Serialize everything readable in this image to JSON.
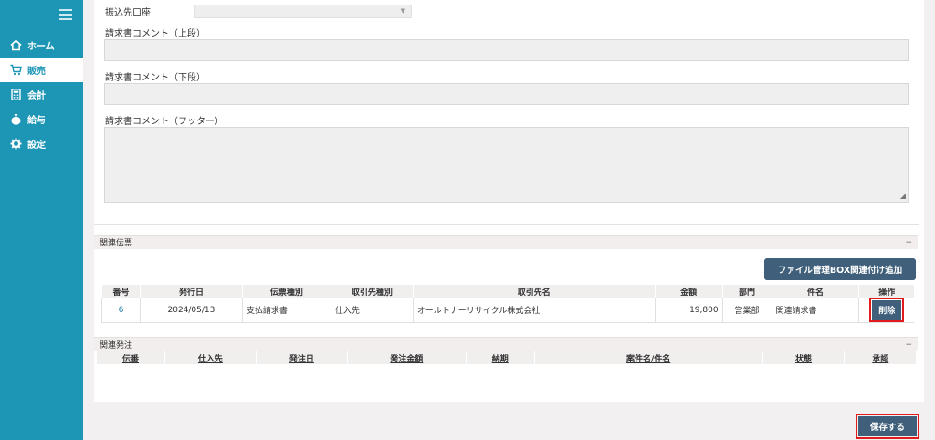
{
  "sidebar": {
    "items": [
      {
        "label": "ホーム",
        "icon": "home-icon"
      },
      {
        "label": "販売",
        "icon": "cart-icon"
      },
      {
        "label": "会計",
        "icon": "calculator-icon"
      },
      {
        "label": "給与",
        "icon": "money-bag-icon"
      },
      {
        "label": "設定",
        "icon": "gear-icon"
      }
    ],
    "active_index": 1,
    "accent": "#1d96b6"
  },
  "form": {
    "bank_label": "振込先口座",
    "bank_value": "",
    "comment_top_label": "請求書コメント（上段）",
    "comment_bottom_label": "請求書コメント（下段）",
    "comment_footer_label": "請求書コメント（フッター）"
  },
  "related_slips": {
    "title": "関連伝票",
    "collapse": "−",
    "file_button": "ファイル管理BOX関連付け追加",
    "headers": [
      "番号",
      "発行日",
      "伝票種別",
      "取引先種別",
      "取引先名",
      "金額",
      "部門",
      "件名",
      "操作"
    ],
    "rows": [
      {
        "no": "6",
        "date": "2024/05/13",
        "type": "支払請求書",
        "partner_type": "仕入先",
        "partner": "オールトナーリサイクル株式会社",
        "amount": "19,800",
        "dept": "営業部",
        "subject": "関連請求書",
        "action": "削除"
      }
    ]
  },
  "related_orders": {
    "title": "関連発注",
    "collapse": "−",
    "headers": [
      "伝番",
      "仕入先",
      "発注日",
      "発注金額",
      "納期",
      "案件名/件名",
      "状態",
      "承認"
    ]
  },
  "footer": {
    "save_label": "保存する"
  },
  "colors": {
    "button": "#3f5f7a",
    "highlight": "#e01b1b"
  }
}
